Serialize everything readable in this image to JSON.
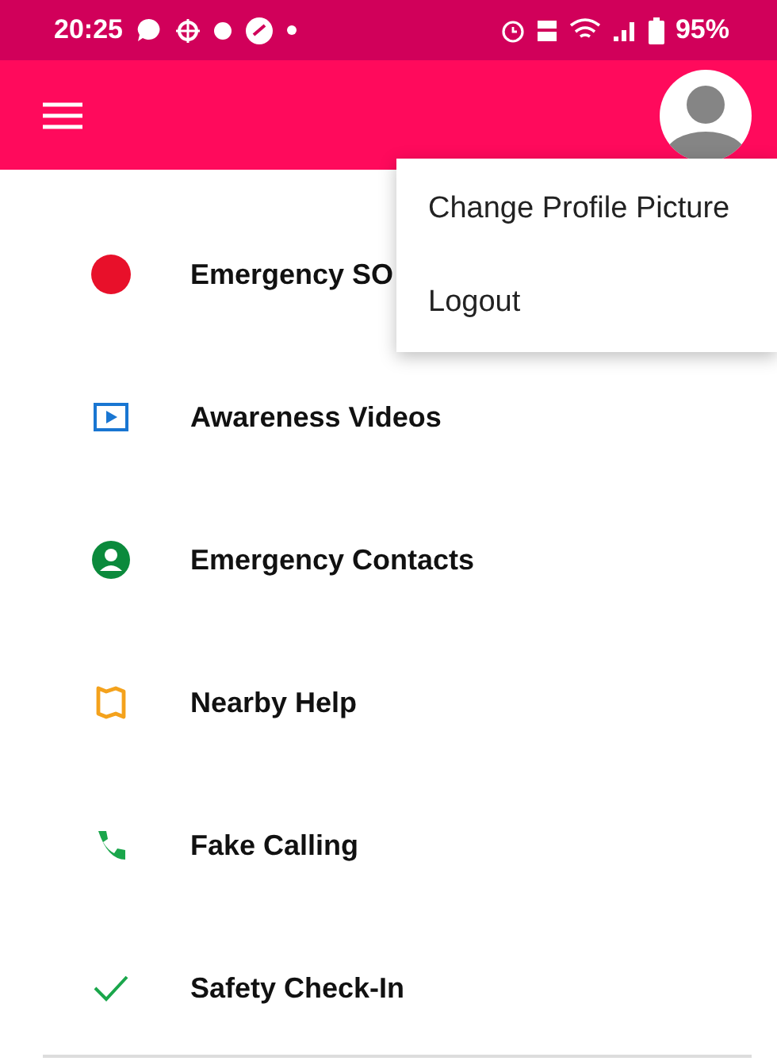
{
  "status_bar": {
    "time": "20:25",
    "battery": "95%"
  },
  "menu": {
    "items": [
      "Change Profile Picture",
      "Logout"
    ]
  },
  "items": [
    {
      "label": "Emergency SO",
      "kind": "sos"
    },
    {
      "label": "Awareness Videos",
      "kind": "video"
    },
    {
      "label": "Emergency Contacts",
      "kind": "contact"
    },
    {
      "label": "Nearby Help",
      "kind": "map"
    },
    {
      "label": "Fake Calling",
      "kind": "call"
    },
    {
      "label": "Safety Check-In",
      "kind": "check"
    }
  ]
}
